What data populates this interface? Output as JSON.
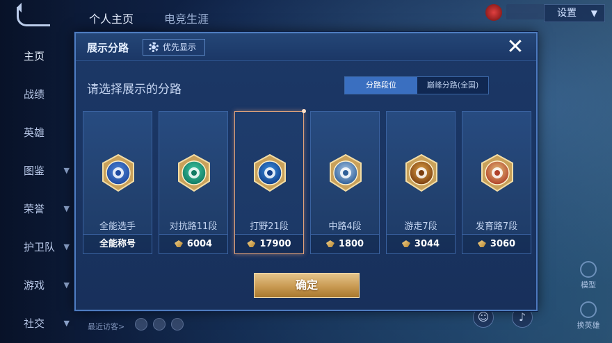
{
  "left_nav": {
    "items": [
      {
        "label": "主页",
        "chevron": false
      },
      {
        "label": "战绩",
        "chevron": false
      },
      {
        "label": "英雄",
        "chevron": false
      },
      {
        "label": "图鉴",
        "chevron": true
      },
      {
        "label": "荣誉",
        "chevron": true
      },
      {
        "label": "护卫队",
        "chevron": true
      },
      {
        "label": "游戏",
        "chevron": true
      },
      {
        "label": "社交",
        "chevron": true
      }
    ]
  },
  "top_tabs": [
    "个人主页",
    "电竞生涯"
  ],
  "settings": {
    "label": "设置",
    "chevron": "▼"
  },
  "right_side": {
    "model_label": "模型",
    "swap_label": "换英雄"
  },
  "recent_visitors_label": "最近访客>",
  "modal": {
    "title": "展示分路",
    "priority_label": "优先显示",
    "close_symbol": "✕",
    "prompt": "请选择展示的分路",
    "toggle": {
      "option_a": "分路段位",
      "option_b": "巅峰分路(全国)"
    },
    "cards": [
      {
        "name": "全能选手",
        "value": "全能称号",
        "has_rank_icon": false,
        "badge_color": "#4d84d6",
        "badge_inner": "#1f4aa0"
      },
      {
        "name": "对抗路11段",
        "value": "6004",
        "has_rank_icon": true,
        "badge_color": "#3fc7a2",
        "badge_inner": "#117a63"
      },
      {
        "name": "打野21段",
        "value": "17900",
        "has_rank_icon": true,
        "badge_color": "#3a8fe0",
        "badge_inner": "#123f8a"
      },
      {
        "name": "中路4段",
        "value": "1800",
        "has_rank_icon": true,
        "badge_color": "#a9c8e8",
        "badge_inner": "#2f5f98"
      },
      {
        "name": "游走7段",
        "value": "3044",
        "has_rank_icon": true,
        "badge_color": "#e0a246",
        "badge_inner": "#7a3e10"
      },
      {
        "name": "发育路7段",
        "value": "3060",
        "has_rank_icon": true,
        "badge_color": "#e6c07a",
        "badge_inner": "#b0412a"
      }
    ],
    "confirm_label": "确定"
  },
  "colors": {
    "accent_blue": "#3a6fc0",
    "selected_border": "#e2a27a",
    "gold": "#c99a52"
  }
}
